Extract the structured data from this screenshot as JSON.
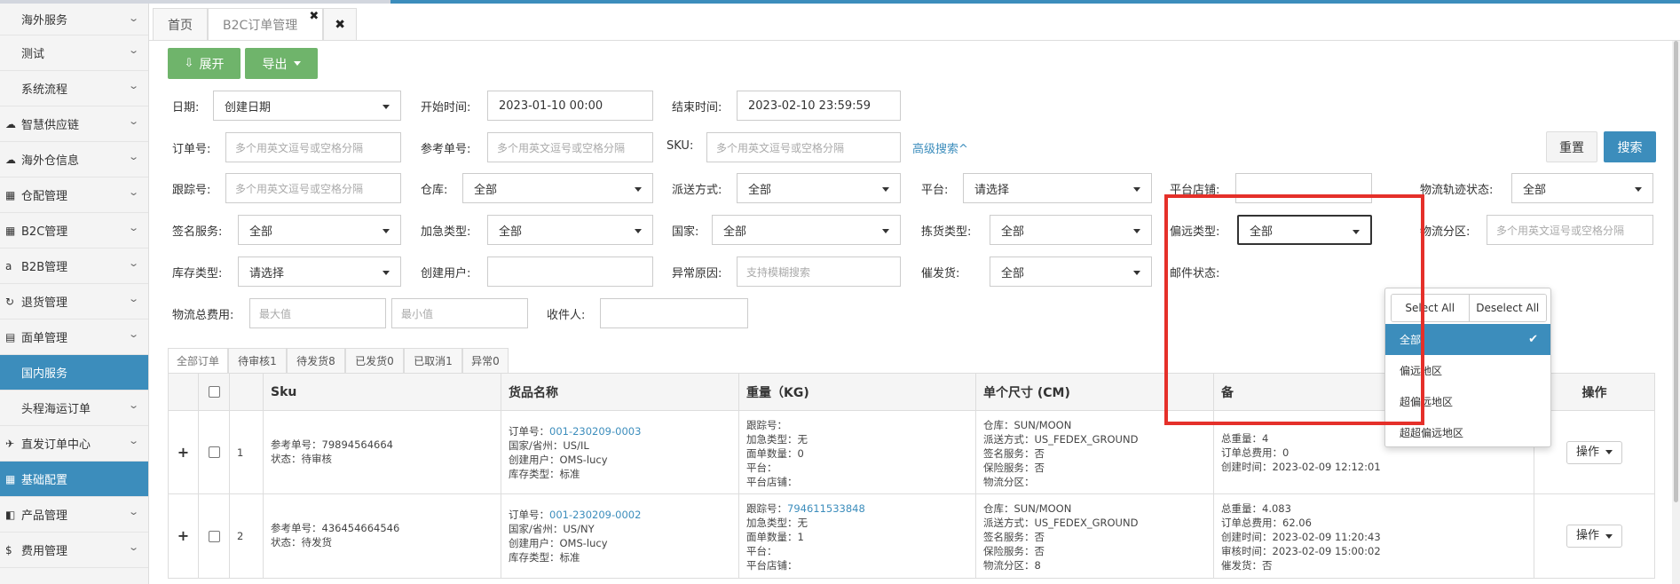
{
  "sidebar": {
    "items": [
      {
        "label": "海外服务",
        "icon": "",
        "sub": true
      },
      {
        "label": "测试",
        "icon": "",
        "sub": true
      },
      {
        "label": "系统流程",
        "icon": "",
        "sub": true
      },
      {
        "label": "智慧供应链",
        "icon": "cloud-icon",
        "sub": false
      },
      {
        "label": "海外仓信息",
        "icon": "cloud-icon",
        "sub": false
      },
      {
        "label": "仓配管理",
        "icon": "grid-icon",
        "sub": false
      },
      {
        "label": "B2C管理",
        "icon": "grid-icon",
        "sub": false
      },
      {
        "label": "B2B管理",
        "icon": "amazon-icon",
        "sub": false
      },
      {
        "label": "退货管理",
        "icon": "refresh-icon",
        "sub": false
      },
      {
        "label": "面单管理",
        "icon": "file-icon",
        "sub": false
      },
      {
        "label": "国内服务",
        "icon": "",
        "sub": true,
        "active": true
      },
      {
        "label": "头程海运订单",
        "icon": "",
        "sub": true
      },
      {
        "label": "直发订单中心",
        "icon": "plane-icon",
        "sub": false
      },
      {
        "label": "基础配置",
        "icon": "table-icon",
        "sub": false,
        "active": true
      },
      {
        "label": "产品管理",
        "icon": "box-icon",
        "sub": false
      },
      {
        "label": "费用管理",
        "icon": "dollar-icon",
        "sub": false
      }
    ]
  },
  "tabs": {
    "home": "首页",
    "current": "B2C订单管理",
    "close_glyph": "✖"
  },
  "toolbar": {
    "expand": "展开",
    "export": "导出",
    "reset": "重置",
    "search": "搜索",
    "advanced": "高级搜索^"
  },
  "filters": {
    "date_label": "日期:",
    "date_value": "创建日期",
    "start_label": "开始时间:",
    "start_value": "2023-01-10 00:00",
    "end_label": "结束时间:",
    "end_value": "2023-02-10 23:59:59",
    "order_no_label": "订单号:",
    "ref_no_label": "参考单号:",
    "sku_label": "SKU:",
    "multi_placeholder": "多个用英文逗号或空格分隔",
    "tracking_label": "跟踪号:",
    "warehouse_label": "仓库:",
    "delivery_label": "派送方式:",
    "platform_label": "平台:",
    "platform_value": "请选择",
    "shop_label": "平台店铺:",
    "logistics_status_label": "物流轨迹状态:",
    "sign_label": "签名服务:",
    "urgent_label": "加急类型:",
    "country_label": "国家:",
    "picking_label": "拣货类型:",
    "remote_label": "偏远类型:",
    "zone_label": "物流分区:",
    "stock_type_label": "库存类型:",
    "stock_type_value": "请选择",
    "creator_label": "创建用户:",
    "exception_label": "异常原因:",
    "exception_placeholder": "支持模糊搜索",
    "urge_label": "催发货:",
    "mail_label": "邮件状态:",
    "fee_label": "物流总费用:",
    "fee_max": "最大值",
    "fee_min": "最小值",
    "receiver_label": "收件人:",
    "all": "全部"
  },
  "status_tabs": [
    "全部订单",
    "待审核1",
    "待发货8",
    "已发货0",
    "已取消1",
    "异常0"
  ],
  "table": {
    "headers": [
      "Sku",
      "货品名称",
      "重量（KG)",
      "单个尺寸 (CM)",
      "备",
      "操作"
    ],
    "op_label": "操作",
    "rows": [
      {
        "num": "1",
        "ref": "参考单号：79894564664",
        "status": "状态：待审核",
        "order_prefix": "订单号：",
        "order_no": "001-230209-0003",
        "country": "国家/省州：US/IL",
        "creator": "创建用户：OMS-lucy",
        "stock": "库存类型：标准",
        "tracking_prefix": "跟踪号：",
        "tracking_no": "",
        "urgent": "加急类型：无",
        "labels": "面单数量：0",
        "platform": "平台：",
        "shop": "平台店铺：",
        "warehouse": "仓库：SUN/MOON",
        "delivery": "派送方式：US_FEDEX_GROUND",
        "sign": "签名服务：否",
        "insure": "保险服务：否",
        "zone": "物流分区：",
        "total_weight": "总重量：4",
        "total_fee": "订单总费用：0",
        "created": "创建时间：2023-02-09 12:12:01",
        "audited": "",
        "urge": ""
      },
      {
        "num": "2",
        "ref": "参考单号：436454664546",
        "status": "状态：待发货",
        "order_prefix": "订单号：",
        "order_no": "001-230209-0002",
        "country": "国家/省州：US/NY",
        "creator": "创建用户：OMS-lucy",
        "stock": "库存类型：标准",
        "tracking_prefix": "跟踪号：",
        "tracking_no": "794611533848",
        "urgent": "加急类型：无",
        "labels": "面单数量：1",
        "platform": "平台：",
        "shop": "平台店铺：",
        "warehouse": "仓库：SUN/MOON",
        "delivery": "派送方式：US_FEDEX_GROUND",
        "sign": "签名服务：否",
        "insure": "保险服务：否",
        "zone": "物流分区：8",
        "total_weight": "总重量：4.083",
        "total_fee": "订单总费用：62.06",
        "created": "创建时间：2023-02-09 11:20:43",
        "audited": "审核时间：2023-02-09 15:00:02",
        "urge": "催发货：否"
      }
    ]
  },
  "dropdown": {
    "select_all": "Select All",
    "deselect_all": "Deselect All",
    "options": [
      "全部",
      "偏远地区",
      "超偏远地区",
      "超超偏远地区"
    ],
    "selected": "全部"
  },
  "colors": {
    "primary": "#3c8dbc",
    "green": "#6fb46b",
    "highlight_box": "#e5302a"
  }
}
